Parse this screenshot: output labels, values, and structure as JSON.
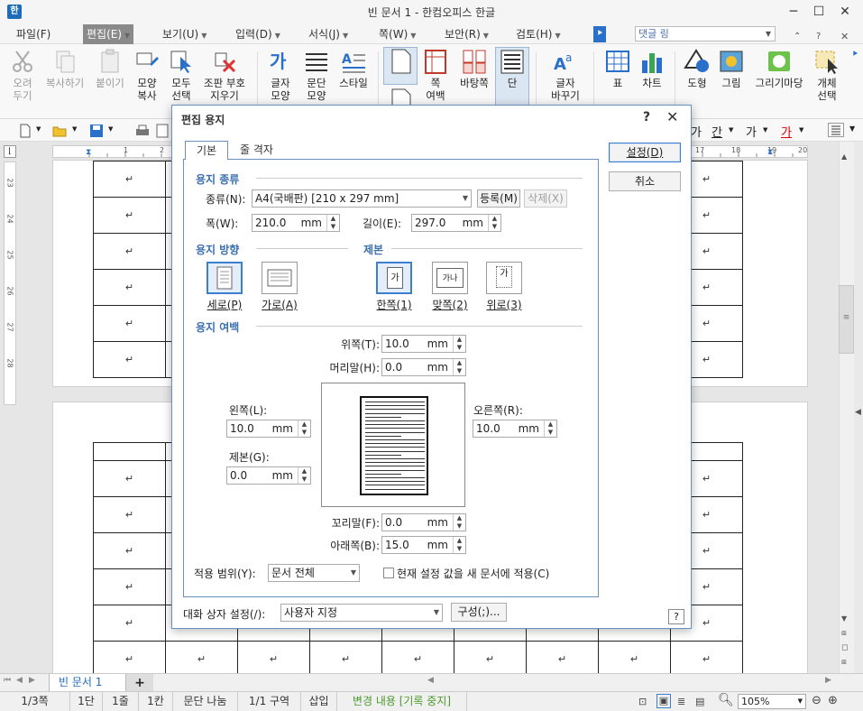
{
  "window": {
    "title": "빈 문서 1 - 한컴오피스 한글",
    "minimize": "─",
    "maximize": "☐",
    "close": "✕"
  },
  "menus": [
    "파일(F)",
    "편집(E)",
    "보기(U)",
    "입력(D)",
    "서식(J)",
    "쪽(W)",
    "보안(R)",
    "검토(H)"
  ],
  "menu_active_index": 1,
  "comment_box": "댓글 링",
  "ribbon": {
    "cut": "오려\n두기",
    "copy": "복사하기",
    "paste": "붙이기",
    "format_copy": "모양\n복사",
    "select_all": "모두\n선택",
    "clear_format": "조판 부호\n지우기",
    "char_shape": "글자\n모양",
    "para_shape": "문단\n모양",
    "style": "스타일",
    "page_border": "쪽\n여백",
    "background": "바탕쪽",
    "column": "단",
    "change_char": "글자\n바꾸기",
    "table": "표",
    "chart": "차트",
    "shape": "도형",
    "picture": "그림",
    "draw_market": "그리기마당",
    "object_select": "개체\n선택"
  },
  "toolbar2": {
    "char_ga1": "가",
    "char_ga2": "간",
    "char_ga3": "가",
    "char_ga4": "가"
  },
  "document": {
    "para_mark": "↵",
    "ruler_numbers": [
      "1",
      "2",
      "17",
      "18",
      "19",
      "20"
    ],
    "vruler_numbers": [
      "23",
      "24",
      "25",
      "26",
      "27",
      "28"
    ]
  },
  "dialog": {
    "title": "편집 용지",
    "help": "?",
    "close": "✕",
    "tabs": [
      "기본",
      "줄 격자"
    ],
    "btn_set": "설정(D)",
    "btn_cancel": "취소",
    "paper_kind_section": "용지 종류",
    "kind_label": "종류(N):",
    "kind_value": "A4(국배판) [210 x 297 mm]",
    "register_btn": "등록(M)",
    "delete_btn": "삭제(X)",
    "width_label": "폭(W):",
    "width_value": "210.0",
    "length_label": "길이(E):",
    "length_value": "297.0",
    "unit_mm": "mm",
    "orientation_section": "용지 방향",
    "portrait": "세로(P)",
    "landscape": "가로(A)",
    "binding_section": "제본",
    "binding_one": "한쪽(1)",
    "binding_facing": "맞쪽(2)",
    "binding_top": "위로(3)",
    "binding_glyph": "가",
    "binding_glyph_facing": "가나",
    "margin_section": "용지 여백",
    "top_label": "위쪽(T):",
    "top_value": "10.0",
    "header_label": "머리말(H):",
    "header_value": "0.0",
    "left_label": "왼쪽(L):",
    "left_value": "10.0",
    "right_label": "오른쪽(R):",
    "right_value": "10.0",
    "gutter_label": "제본(G):",
    "gutter_value": "0.0",
    "footer_label": "꼬리말(F):",
    "footer_value": "0.0",
    "bottom_label": "아래쪽(B):",
    "bottom_value": "15.0",
    "scope_label": "적용 범위(Y):",
    "scope_value": "문서 전체",
    "apply_new_label": "현재 설정 값을 새 문서에 적용(C)",
    "dialog_setting_label": "대화 상자 설정(/):",
    "dialog_setting_value": "사용자 지정",
    "config_btn": "구성(;)...",
    "help_small": "?"
  },
  "tabs": {
    "doc_tab": "빈 문서 1",
    "add": "+"
  },
  "status": {
    "page": "1/3쪽",
    "column": "1단",
    "line": "1줄",
    "col": "1칸",
    "para_break": "문단 나눔",
    "section": "1/1 구역",
    "insert": "삽입",
    "track": "변경 내용 [기록 중지]",
    "zoom": "105%"
  },
  "colors": {
    "accent": "#3c7fd1",
    "section_title": "#3a6fb0",
    "track_text": "#4a9a2a"
  }
}
